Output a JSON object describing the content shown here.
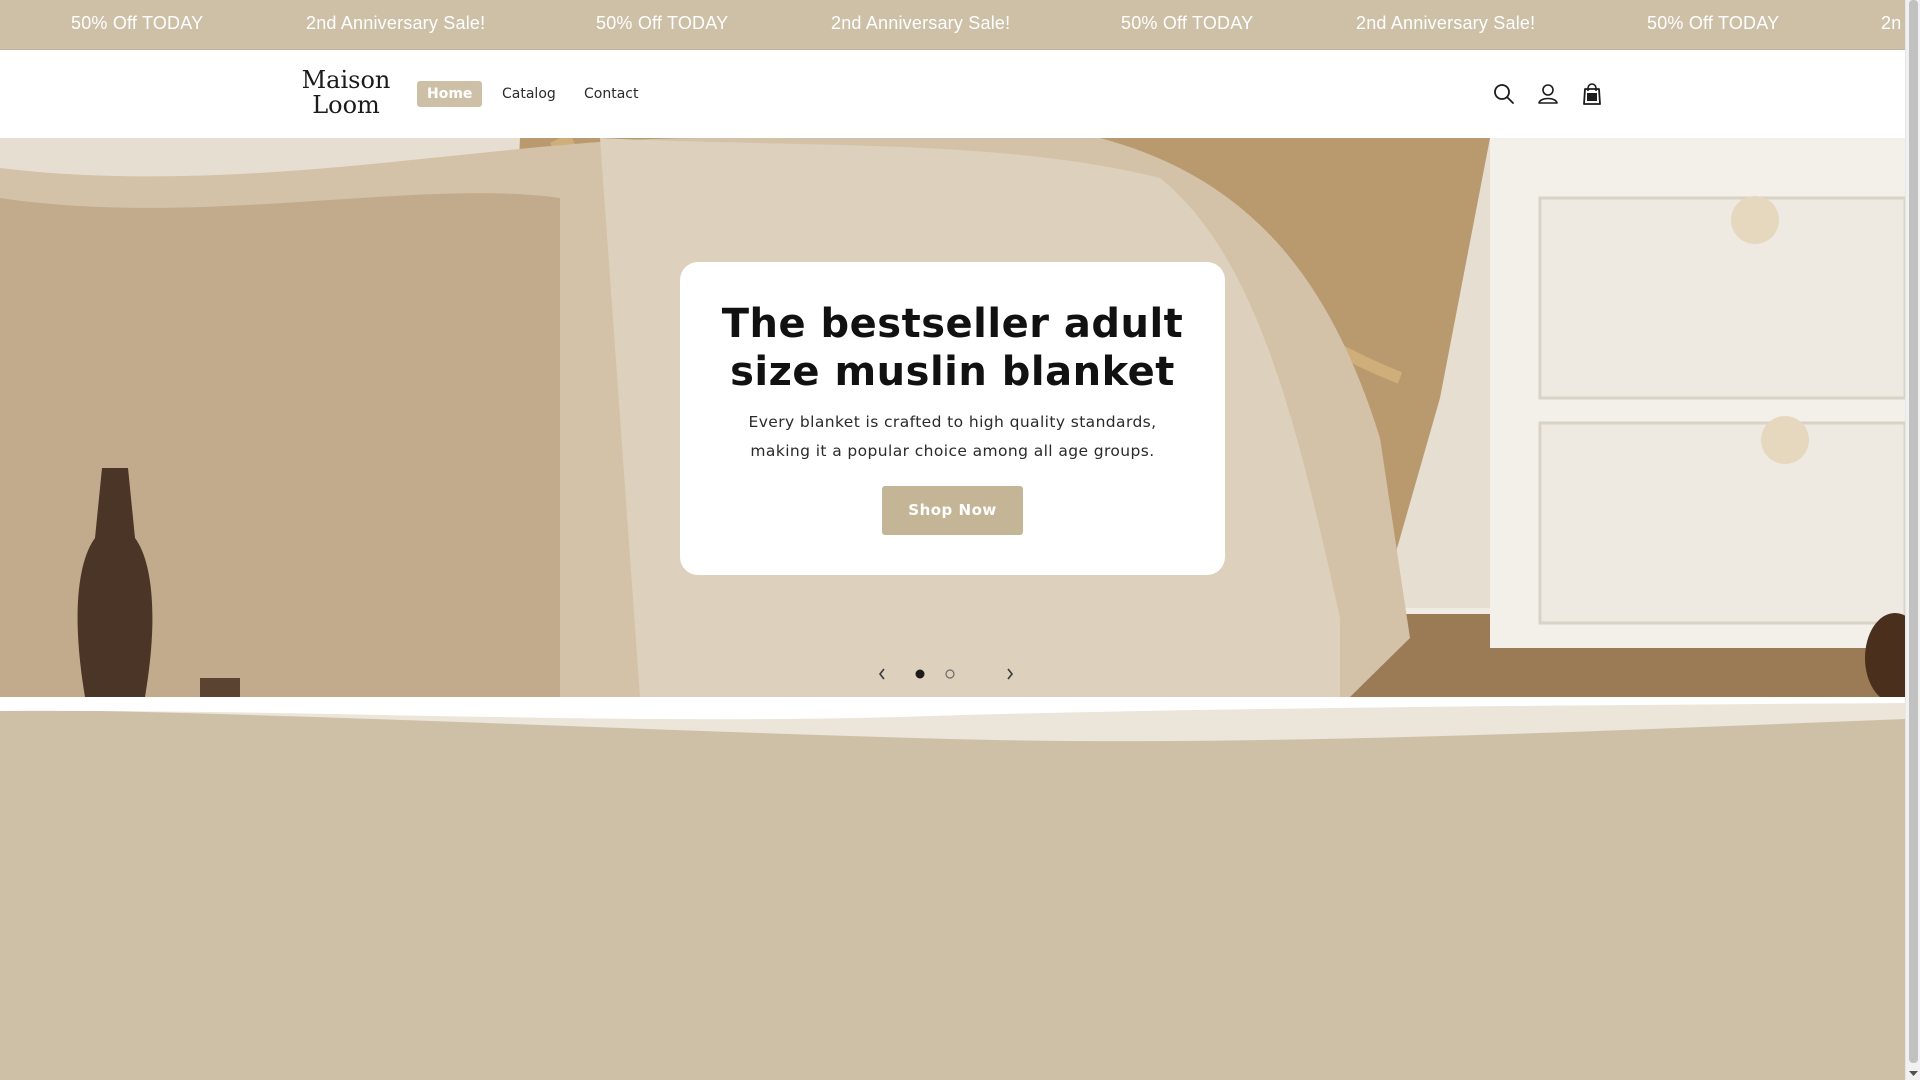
{
  "announcement": {
    "items": [
      "50% Off TODAY",
      "2nd Anniversary Sale!",
      "50% Off TODAY",
      "2nd Anniversary Sale!",
      "50% Off TODAY",
      "2nd Anniversary Sale!",
      "50% Off TODAY",
      "2n"
    ]
  },
  "header": {
    "logo_line1": "Maison",
    "logo_line2": "Loom",
    "nav": [
      "Home",
      "Catalog",
      "Contact"
    ],
    "active_nav": "Home",
    "icons": [
      "search-icon",
      "account-icon",
      "cart-icon"
    ]
  },
  "hero": {
    "title": "The bestseller adult size muslin blanket",
    "subtitle": "Every blanket is crafted to high quality standards, making it a popular choice among all age groups.",
    "button_label": "Shop Now",
    "slide_count": 2,
    "active_slide": 1
  },
  "colors": {
    "accent": "#cdc0a7",
    "button": "#c4b597",
    "wave_light": "#ebe5da"
  }
}
